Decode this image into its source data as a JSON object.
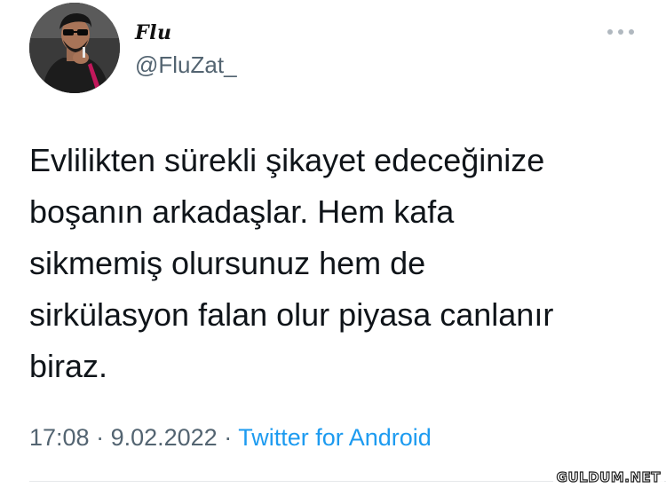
{
  "author": {
    "display_name": "Flu",
    "handle": "@FluZat_",
    "avatar_icon": "profile-photo"
  },
  "tweet": {
    "text": "Evlilikten sürekli şikayet edeceğinize\nboşanın arkadaşlar. Hem kafa\nsikmemiş olursunuz hem de\nsirkülasyon falan olur piyasa canlanır\nbiraz.",
    "time": "17:08",
    "separator": " · ",
    "date": "9.02.2022",
    "source": "Twitter for Android"
  },
  "watermark": "GULDUM.NET",
  "colors": {
    "text": "#0f1419",
    "secondary": "#536471",
    "link": "#1d9bf0"
  }
}
